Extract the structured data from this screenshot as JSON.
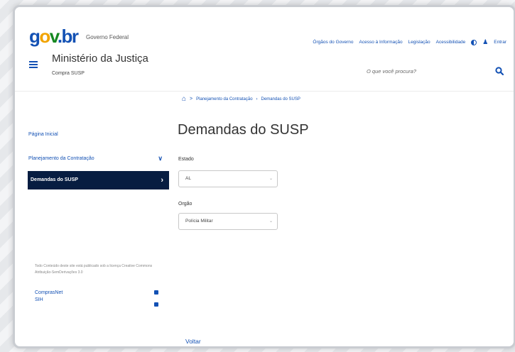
{
  "header": {
    "logo": {
      "g": "g",
      "o": "o",
      "v": "v",
      "br": ".br"
    },
    "gov_label": "Governo Federal",
    "top_links": [
      "Órgãos do Governo",
      "Acesso à Informação",
      "Legislação",
      "Acessibilidade"
    ],
    "login_label": "Entrar",
    "ministry": "Ministério da Justiça",
    "subtitle": "Compra SUSP",
    "search_placeholder": "O que você procura?"
  },
  "sidebar": {
    "home": "Página Inicial",
    "planning": "Planejamento da Contratação",
    "active": "Demandas do SUSP",
    "license": "Todo Conteúdo deste site está publicado sob a licença Creative Commons Atribuição-SemDerivações 3.0",
    "links": [
      "ComprasNet",
      "SIH"
    ]
  },
  "breadcrumb": {
    "item1": "Planejamento da Contratação",
    "sep": "›",
    "item2": "Demandas do SUSP"
  },
  "main": {
    "title": "Demandas do SUSP",
    "estado_label": "Estado",
    "estado_value": "AL",
    "orgao_label": "Orgão",
    "orgao_value": "Polícia Militar",
    "back": "Voltar"
  },
  "colors": {
    "primary": "#1351b4",
    "active_bg": "#071d41",
    "logo_yellow": "#f1a300",
    "logo_green": "#168821"
  }
}
